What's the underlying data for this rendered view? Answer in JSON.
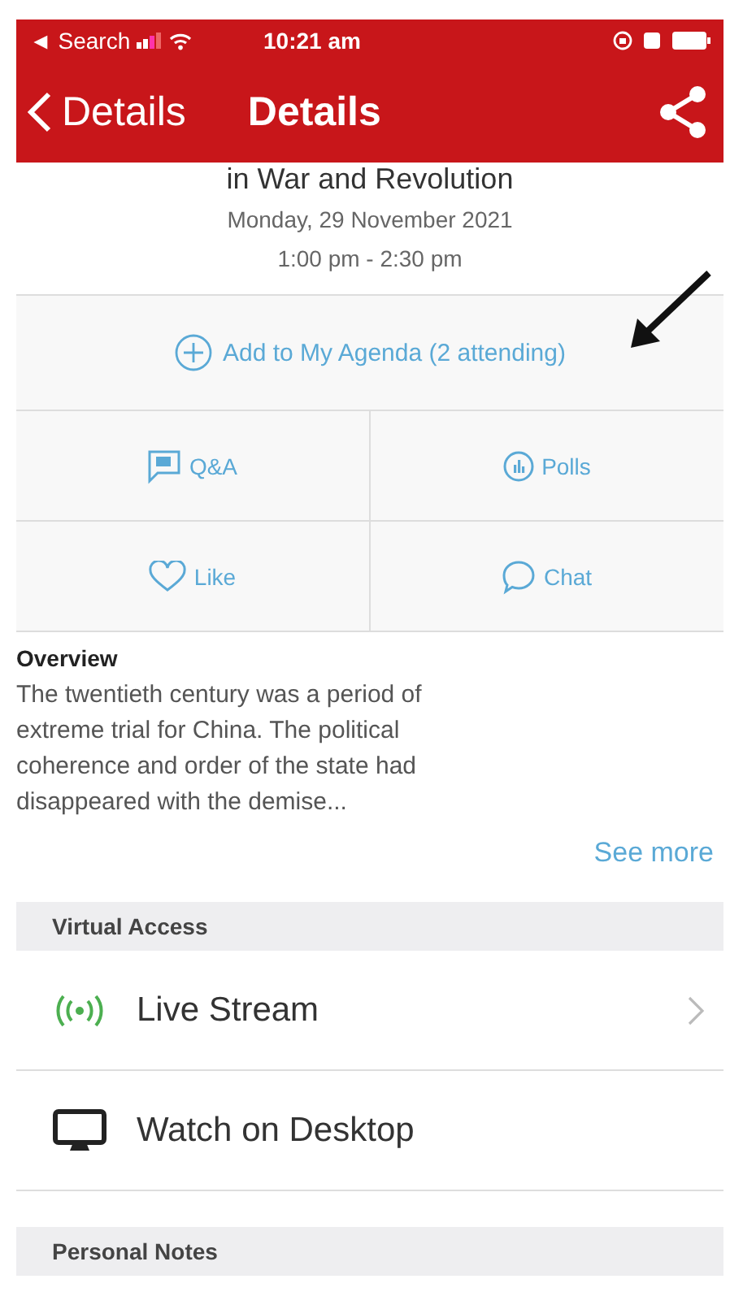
{
  "status_bar": {
    "back_label": "◄ Search",
    "time": "10:21 am"
  },
  "nav_bar": {
    "back": "Details",
    "title": "Details"
  },
  "session": {
    "title": "in War and Revolution",
    "date": "Monday, 29 November 2021",
    "time": "1:00 pm - 2:30 pm"
  },
  "agenda_button": {
    "label": "Add to My Agenda (2 attending)"
  },
  "actions": [
    {
      "kind": "qa",
      "label": "Q&A"
    },
    {
      "kind": "polls",
      "label": "Polls"
    },
    {
      "kind": "like",
      "label": "Like"
    },
    {
      "kind": "chat",
      "label": "Chat"
    }
  ],
  "overview": {
    "heading": "Overview",
    "text": "The twentieth century was a period of extreme trial for China. The political coherence and order of the state had disappeared with the demise...",
    "link": "See more"
  },
  "sections": [
    {
      "title": "Virtual Access",
      "items": [
        {
          "kind": "live",
          "label": "Live Stream",
          "chevron": true
        },
        {
          "kind": "desktop",
          "label": "Watch on Desktop",
          "chevron": false
        }
      ]
    },
    {
      "title": "Personal Notes"
    }
  ]
}
